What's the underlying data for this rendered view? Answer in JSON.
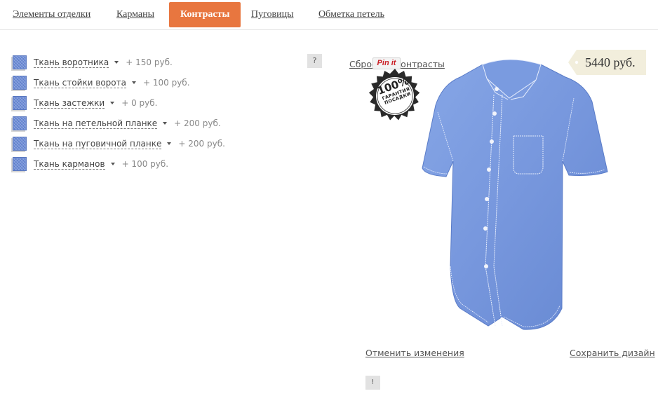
{
  "tabs": [
    {
      "label": "Элементы отделки",
      "active": false
    },
    {
      "label": "Карманы",
      "active": false
    },
    {
      "label": "Контрасты",
      "active": true
    },
    {
      "label": "Пуговицы",
      "active": false
    },
    {
      "label": "Обметка петель",
      "active": false
    }
  ],
  "options": [
    {
      "label": "Ткань воротника",
      "price": "+ 150 руб."
    },
    {
      "label": "Ткань стойки ворота",
      "price": "+ 100 руб."
    },
    {
      "label": "Ткань застежки",
      "price": "+ 0 руб."
    },
    {
      "label": "Ткань на петельной планке",
      "price": "+ 200 руб."
    },
    {
      "label": "Ткань на пуговичной планке",
      "price": "+ 200 руб."
    },
    {
      "label": "Ткань карманов",
      "price": "+ 100 руб."
    }
  ],
  "help_button": "?",
  "reset_link": "Сбросить контрасты",
  "pinit": "Pin it",
  "price": "5440 руб.",
  "badge": {
    "percent": "100%",
    "line1": "ГАРАНТИЯ",
    "line2": "ПОСАДКИ"
  },
  "cancel_link": "Отменить изменения",
  "save_link": "Сохранить дизайн",
  "info_button": "!",
  "colors": {
    "accent": "#e8763f",
    "shirt": "#7a9be0",
    "price_tag": "#f2eedc"
  }
}
